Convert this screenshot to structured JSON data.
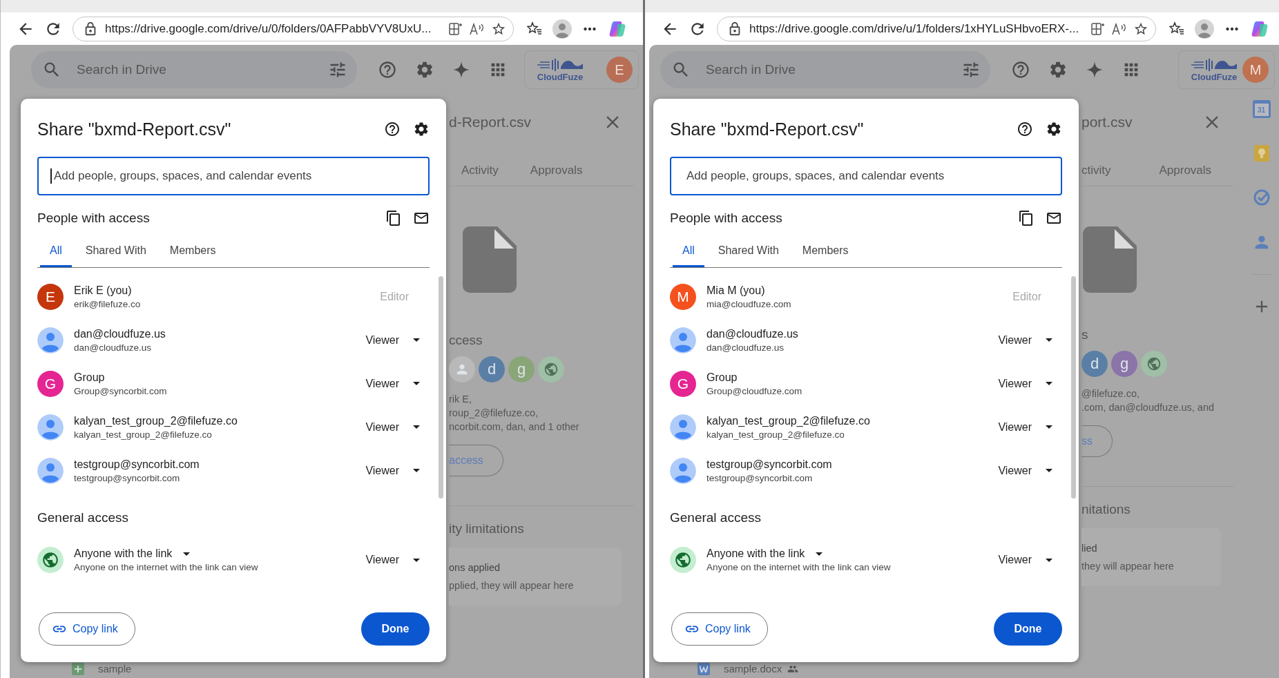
{
  "panes": [
    {
      "browser": {
        "url": "https://drive.google.com/drive/u/0/folders/0AFPabbVYV8UxU..."
      },
      "drive_header": {
        "search_placeholder": "Search in Drive",
        "logo_text": "CloudFuze",
        "account": {
          "initial": "E",
          "color": "#b86e55"
        }
      },
      "dialog": {
        "title": "Share \"bxmd-Report.csv\"",
        "add_field": {
          "placeholder": "Add people, groups, spaces, and calendar events",
          "focused": true
        },
        "people_heading": "People with access",
        "tabs": [
          {
            "label": "All",
            "selected": true
          },
          {
            "label": "Shared With",
            "selected": false
          },
          {
            "label": "Members",
            "selected": false
          }
        ],
        "people": [
          {
            "name": "Erik E (you)",
            "email": "erik@filefuze.co",
            "kind": "initial",
            "initial": "E",
            "color": "#c5360d",
            "role": "Editor",
            "role_disabled": true
          },
          {
            "name": "dan@cloudfuze.us",
            "email": "dan@cloudfuze.us",
            "kind": "person",
            "role": "Viewer",
            "role_disabled": false
          },
          {
            "name": "Group",
            "email": "Group@syncorbit.com",
            "kind": "initial",
            "initial": "G",
            "color": "#e52592",
            "role": "Viewer",
            "role_disabled": false
          },
          {
            "name": "kalyan_test_group_2@filefuze.co",
            "email": "kalyan_test_group_2@filefuze.co",
            "kind": "person",
            "role": "Viewer",
            "role_disabled": false
          },
          {
            "name": "testgroup@syncorbit.com",
            "email": "testgroup@syncorbit.com",
            "kind": "person",
            "role": "Viewer",
            "role_disabled": false
          }
        ],
        "general_heading": "General access",
        "general": {
          "scope": "Anyone with the link",
          "description": "Anyone on the internet with the link can view",
          "role": "Viewer"
        },
        "copy_link": "Copy link",
        "done": "Done"
      },
      "details_panel": {
        "title": "d-Report.csv",
        "tabs": [
          "Activity",
          "Approvals"
        ],
        "access_heading": "ccess",
        "avatars": [
          {
            "kind": "person",
            "color": "#b9b9b9"
          },
          {
            "kind": "initial",
            "letter": "d",
            "color": "#5a7fa6"
          },
          {
            "kind": "initial",
            "letter": "g",
            "color": "#8aa678"
          },
          {
            "kind": "globe",
            "color": "#9fbfa6"
          }
        ],
        "access_summary": [
          "rik E,",
          "roup_2@filefuze.co,",
          "ncorbit.com, dan, and 1 other"
        ],
        "access_button": "access",
        "limitations_heading": "ity limitations",
        "limitations_title": "ons applied",
        "limitations_text": "pplied, they will appear here"
      },
      "file_list": [
        {
          "name": "sample",
          "kind": "sheet",
          "shared": false
        }
      ]
    },
    {
      "browser": {
        "url": "https://drive.google.com/drive/u/1/folders/1xHYLuSHbvoERX-..."
      },
      "drive_header": {
        "search_placeholder": "Search in Drive",
        "logo_text": "CloudFuze",
        "account": {
          "initial": "M",
          "color": "#c0714f"
        }
      },
      "dialog": {
        "title": "Share \"bxmd-Report.csv\"",
        "add_field": {
          "placeholder": "Add people, groups, spaces, and calendar events",
          "focused": false
        },
        "people_heading": "People with access",
        "tabs": [
          {
            "label": "All",
            "selected": true
          },
          {
            "label": "Shared With",
            "selected": false
          },
          {
            "label": "Members",
            "selected": false
          }
        ],
        "people": [
          {
            "name": "Mia M (you)",
            "email": "mia@cloudfuze.com",
            "kind": "initial",
            "initial": "M",
            "color": "#f4511e",
            "role": "Editor",
            "role_disabled": true
          },
          {
            "name": "dan@cloudfuze.us",
            "email": "dan@cloudfuze.us",
            "kind": "person",
            "role": "Viewer",
            "role_disabled": false
          },
          {
            "name": "Group",
            "email": "Group@cloudfuze.com",
            "kind": "initial",
            "initial": "G",
            "color": "#e52592",
            "role": "Viewer",
            "role_disabled": false
          },
          {
            "name": "kalyan_test_group_2@filefuze.co",
            "email": "kalyan_test_group_2@filefuze.co",
            "kind": "person",
            "role": "Viewer",
            "role_disabled": false
          },
          {
            "name": "testgroup@syncorbit.com",
            "email": "testgroup@syncorbit.com",
            "kind": "person",
            "role": "Viewer",
            "role_disabled": false
          }
        ],
        "general_heading": "General access",
        "general": {
          "scope": "Anyone with the link",
          "description": "Anyone on the internet with the link can view",
          "role": "Viewer"
        },
        "copy_link": "Copy link",
        "done": "Done"
      },
      "details_panel": {
        "title": "port.csv",
        "tabs": [
          "ctivity",
          "Approvals"
        ],
        "access_heading": "s",
        "avatars": [
          {
            "kind": "initial",
            "letter": "d",
            "color": "#5a7fa6"
          },
          {
            "kind": "initial",
            "letter": "g",
            "color": "#8a74a8"
          },
          {
            "kind": "globe",
            "color": "#9fbfa6"
          }
        ],
        "access_summary": [
          "@filefuze.co,",
          ".com, dan@cloudfuze.us, and"
        ],
        "access_button": "ss",
        "limitations_heading": "nitations",
        "limitations_title": "lied",
        "limitations_text": "they will appear here"
      },
      "file_list": [
        {
          "name": "sample.docx",
          "kind": "doc",
          "shared": true
        }
      ],
      "side_rail": [
        {
          "kind": "calendar",
          "label": "31"
        },
        {
          "kind": "keep"
        },
        {
          "kind": "tasks"
        },
        {
          "kind": "contacts"
        },
        {
          "kind": "add"
        }
      ]
    }
  ]
}
